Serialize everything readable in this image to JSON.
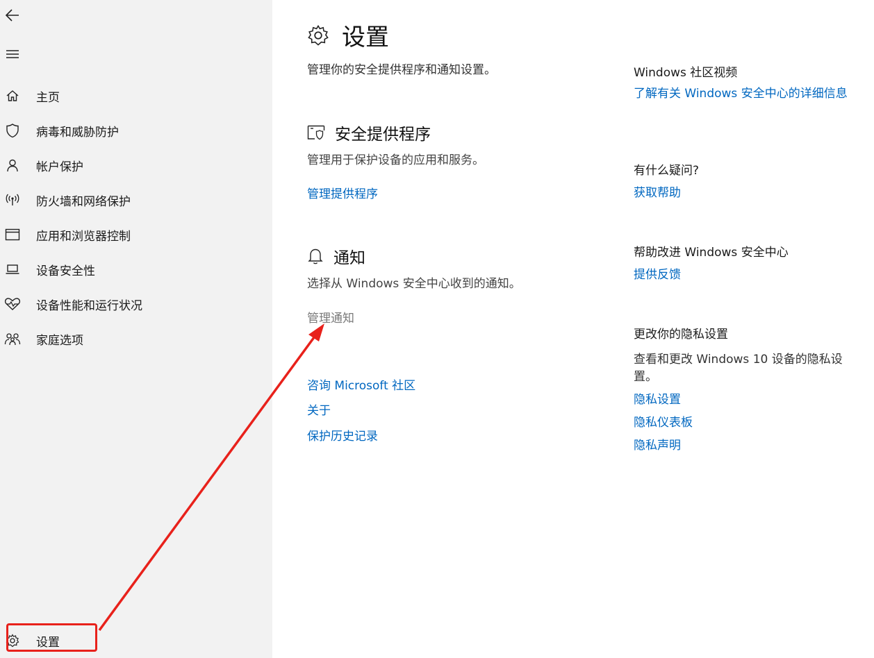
{
  "sidebar": {
    "nav_items": [
      {
        "label": "主页",
        "icon": "home-icon"
      },
      {
        "label": "病毒和威胁防护",
        "icon": "shield-icon"
      },
      {
        "label": "帐户保护",
        "icon": "person-icon"
      },
      {
        "label": "防火墙和网络保护",
        "icon": "wifi-antenna-icon"
      },
      {
        "label": "应用和浏览器控制",
        "icon": "app-window-icon"
      },
      {
        "label": "设备安全性",
        "icon": "laptop-icon"
      },
      {
        "label": "设备性能和运行状况",
        "icon": "heart-pulse-icon"
      },
      {
        "label": "家庭选项",
        "icon": "family-icon"
      }
    ],
    "settings_label": "设置"
  },
  "main": {
    "title": "设置",
    "description": "管理你的安全提供程序和通知设置。",
    "providers": {
      "title": "安全提供程序",
      "description": "管理用于保护设备的应用和服务。",
      "link": "管理提供程序"
    },
    "notifications": {
      "title": "通知",
      "description": "选择从 Windows 安全中心收到的通知。",
      "link": "管理通知"
    },
    "footer_links": [
      "咨询 Microsoft 社区",
      "关于",
      "保护历史记录"
    ]
  },
  "right_column": {
    "community": {
      "heading": "Windows 社区视频",
      "link": "了解有关 Windows 安全中心的详细信息"
    },
    "help": {
      "heading": "有什么疑问?",
      "link": "获取帮助"
    },
    "feedback": {
      "heading": "帮助改进 Windows 安全中心",
      "link": "提供反馈"
    },
    "privacy": {
      "heading": "更改你的隐私设置",
      "text": "查看和更改 Windows 10 设备的隐私设置。",
      "links": [
        "隐私设置",
        "隐私仪表板",
        "隐私声明"
      ]
    }
  },
  "colors": {
    "link": "#0067c0",
    "annotation": "#e8211b",
    "sidebar_bg": "#f2f2f2"
  }
}
